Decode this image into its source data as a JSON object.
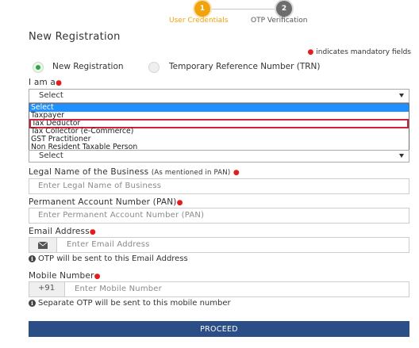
{
  "stepper": {
    "steps": [
      {
        "number": "1",
        "label": "User Credentials"
      },
      {
        "number": "2",
        "label": "OTP Verification"
      }
    ]
  },
  "heading": "New Registration",
  "mandatory_note": "indicates mandatory fields",
  "radios": [
    {
      "label": "New Registration",
      "checked": true
    },
    {
      "label": "Temporary Reference Number (TRN)",
      "checked": false
    }
  ],
  "i_am_a": {
    "label": "I am a",
    "selected": "Select",
    "options": [
      "Select",
      "Taxpayer",
      "Tax Deductor",
      "Tax Collector (e-Commerce)",
      "GST Practitioner",
      "Non Resident Taxable Person"
    ],
    "second_select": "Select"
  },
  "legal_name": {
    "label": "Legal Name of the Business",
    "note": "(As mentioned in PAN)",
    "placeholder": "Enter Legal Name of Business"
  },
  "pan": {
    "label": "Permanent Account Number (PAN)",
    "placeholder": "Enter Permanent Account Number (PAN)"
  },
  "email": {
    "label": "Email Address",
    "placeholder": "Enter Email Address",
    "hint": "OTP will be sent to this Email Address"
  },
  "mobile": {
    "label": "Mobile Number",
    "prefix": "+91",
    "placeholder": "Enter Mobile Number",
    "hint": "Separate OTP will be sent to this mobile number"
  },
  "proceed_label": "PROCEED",
  "colors": {
    "accent": "#f0a30a",
    "primary": "#2c4e86",
    "required": "#e31e1e",
    "radio": "#2fa544",
    "highlight": "#1e90ff",
    "callout": "#d0223a"
  }
}
